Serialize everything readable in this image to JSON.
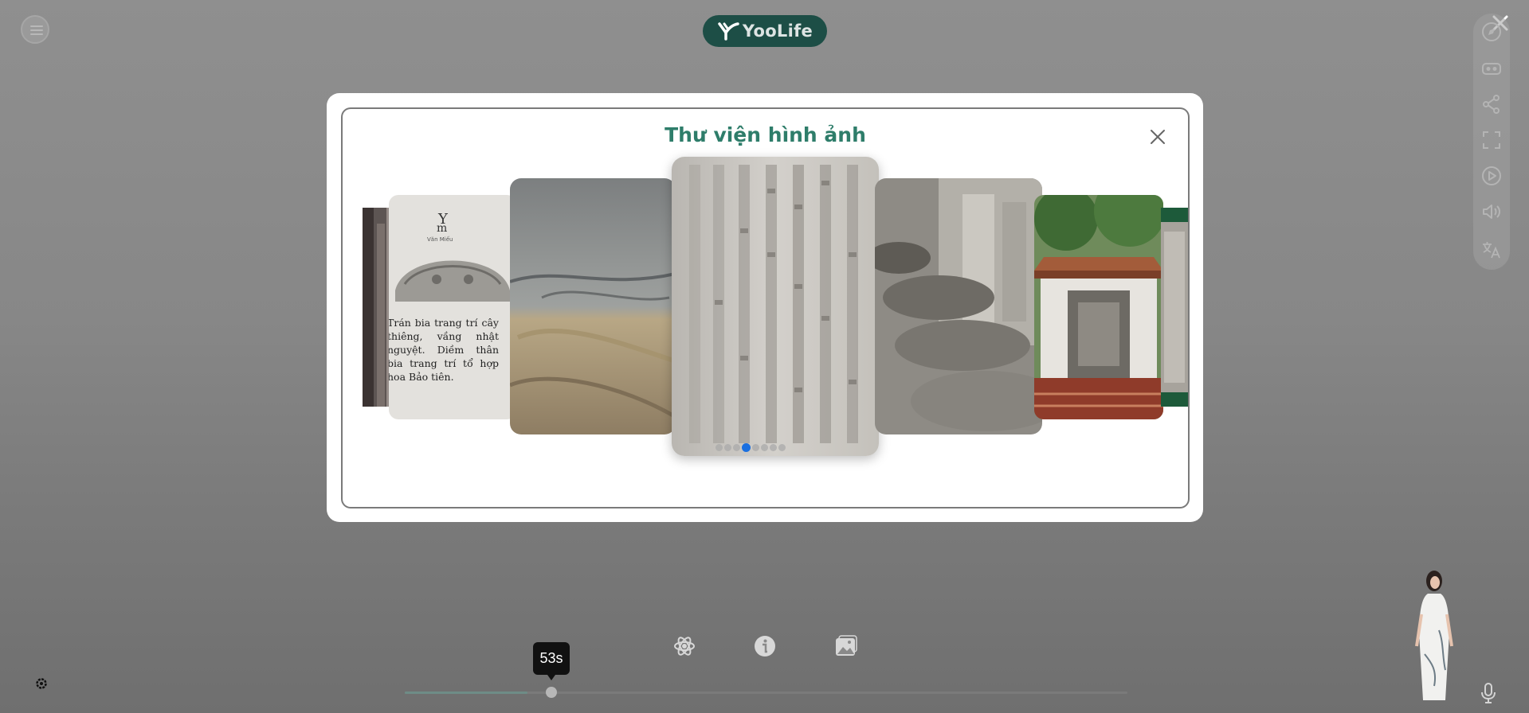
{
  "brand": {
    "name": "YooLife",
    "color": "#1d4e46"
  },
  "header": {
    "menu_icon": "hamburger-menu-icon",
    "close_icon": "close-icon"
  },
  "right_toolbar": {
    "icons": [
      "compass-icon",
      "vr-headset-icon",
      "share-icon",
      "fullscreen-icon",
      "play-icon",
      "volume-icon",
      "translate-icon"
    ]
  },
  "gallery": {
    "title": "Thư viện hình ảnh",
    "title_color": "#2e7d6a",
    "close_icon": "close-icon",
    "slides": [
      {
        "name": "slide-stone-carving-edge"
      },
      {
        "name": "slide-stele-info-card",
        "caption": "Trán bia trang trí cây thiêng, vầng nhật nguyệt. Diềm thân bia trang trí tổ hợp hoa Bảo tiên."
      },
      {
        "name": "slide-turtle-base-carving"
      },
      {
        "name": "slide-chinese-inscription",
        "active": true
      },
      {
        "name": "slide-turtle-stele-row"
      },
      {
        "name": "slide-stele-pavilion"
      },
      {
        "name": "slide-relief-edge"
      }
    ],
    "dots_total": 8,
    "active_dot": 3,
    "accent": "#1a6fe0"
  },
  "bottom_bar": {
    "icons": [
      "atom-icon",
      "info-icon",
      "gallery-icon"
    ],
    "timeline": {
      "label": "53s",
      "progress": 0.17
    },
    "settings_icon": "gear-icon",
    "mic_icon": "microphone-icon"
  }
}
